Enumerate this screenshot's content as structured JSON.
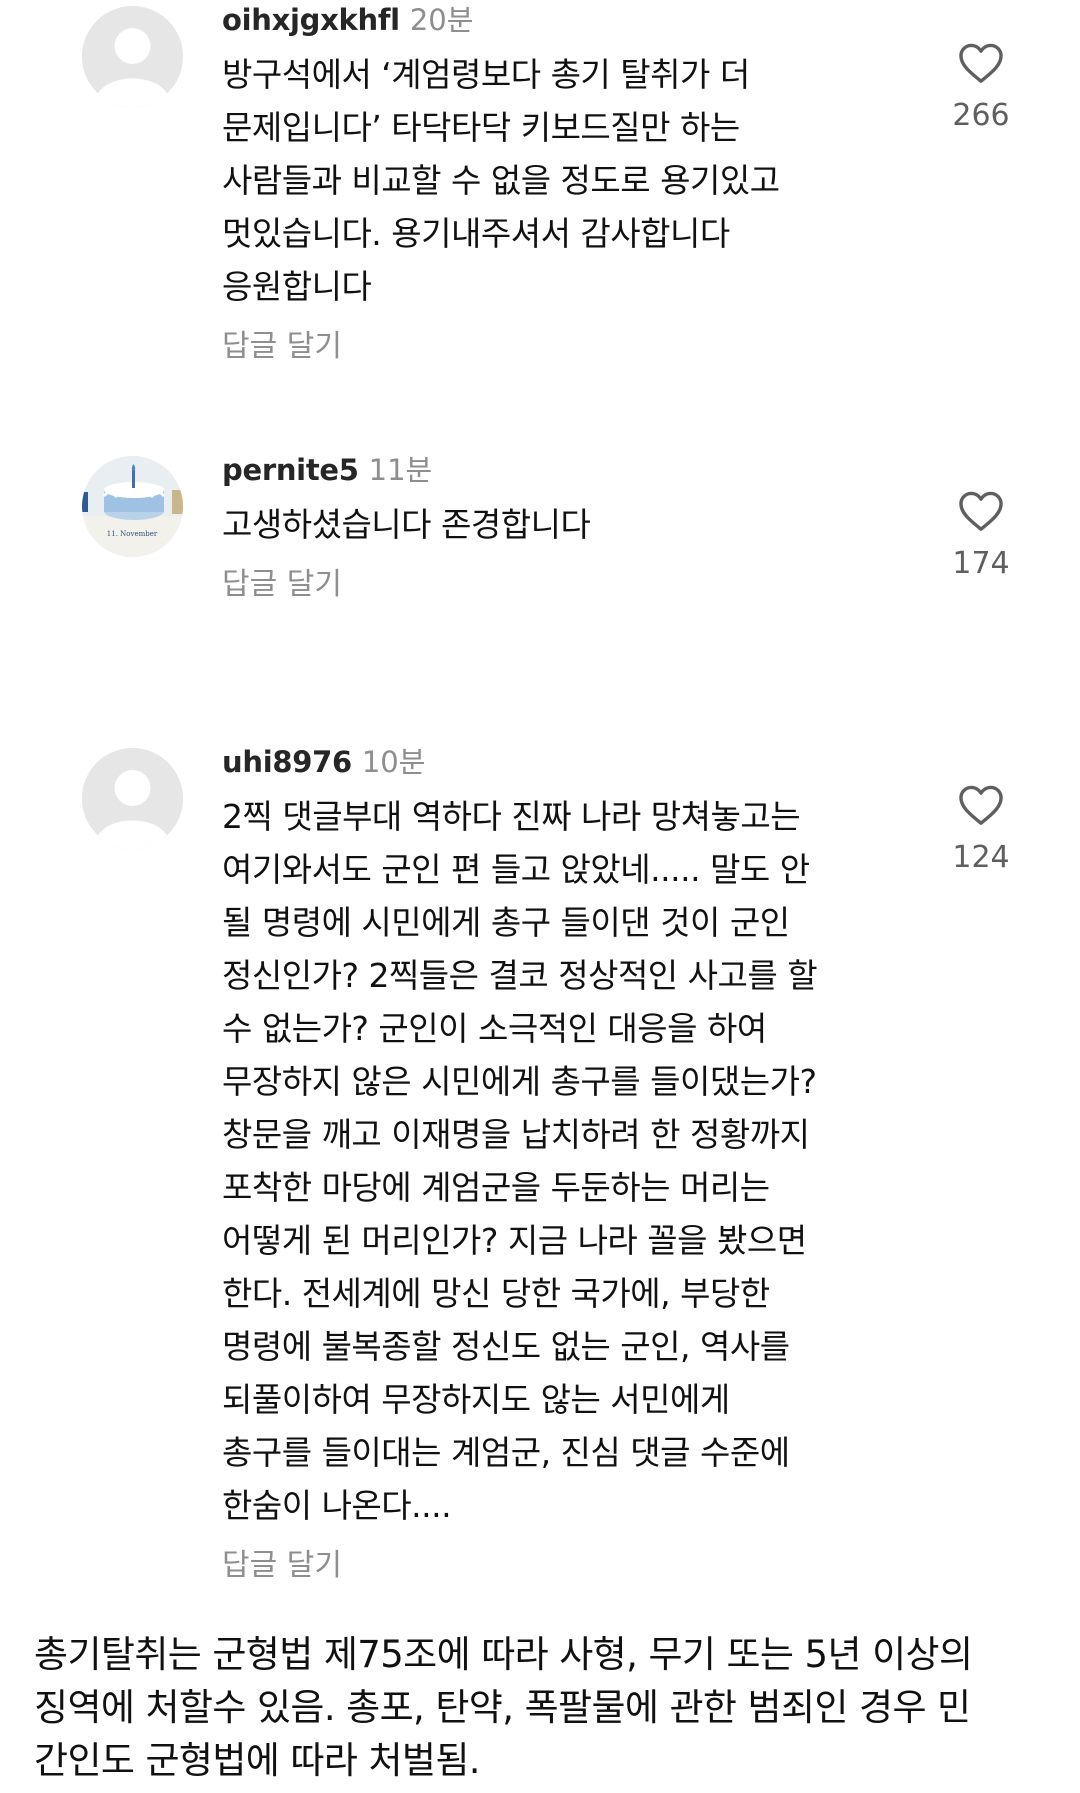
{
  "comments": [
    {
      "username": "oihxjgxkhfl",
      "time": "20분",
      "avatar_icon": "default-avatar-icon",
      "lines": [
        "방구석에서 ‘계엄령보다 총기 탈취가 더",
        "문제입니다’ 타닥타닥 키보드질만 하는",
        "사람들과 비교할 수 없을 정도로 용기있고",
        "멋있습니다. 용기내주셔서 감사합니다",
        "응원합니다"
      ],
      "reply_label": "답글 달기",
      "likes": "266"
    },
    {
      "username": "pernite5",
      "time": "11분",
      "avatar_icon": "cake-photo-avatar",
      "avatar_text": "11. November",
      "lines": [
        "고생하셨습니다 존경합니다"
      ],
      "reply_label": "답글 달기",
      "likes": "174"
    },
    {
      "username": "uhi8976",
      "time": "10분",
      "avatar_icon": "default-avatar-icon",
      "lines": [
        "2찍 댓글부대 역하다 진짜 나라 망쳐놓고는",
        "여기와서도 군인 편 들고 앉았네..... 말도 안",
        "될 명령에 시민에게 총구 들이댄 것이 군인",
        "정신인가? 2찍들은 결코 정상적인 사고를 할",
        "수 없는가? 군인이 소극적인 대응을 하여",
        "무장하지 않은 시민에게 총구를 들이댔는가?",
        "창문을 깨고 이재명을 납치하려 한 정황까지",
        "포착한 마당에 계엄군을 두둔하는 머리는",
        "어떻게 된 머리인가? 지금 나라 꼴을 봤으면",
        "한다. 전세계에 망신 당한 국가에, 부당한",
        "명령에 불복종할 정신도 없는 군인, 역사를",
        "되풀이하여 무장하지도 않는 서민에게",
        "총구를 들이대는 계엄군, 진심 댓글 수준에",
        "한숨이 나온다...."
      ],
      "reply_label": "답글 달기",
      "likes": "124"
    }
  ],
  "note": {
    "lines": [
      "총기탈취는 군형법 제75조에 따라 사형, 무기 또는 5년 이상의",
      "징역에 처할수 있음. 총포, 탄약, 폭팔물에 관한 범죄인 경우 민",
      "간인도 군형법에 따라 처벌됨."
    ]
  },
  "colors": {
    "username": "#262626",
    "secondary_text": "#8e8e8e",
    "body_text": "#111111",
    "avatar_bg": "#e6e6e6",
    "avatar_glyph": "#ffffff",
    "heart_outline": "#5f5f5f"
  },
  "icons": {
    "like": "heart-outline-icon"
  }
}
